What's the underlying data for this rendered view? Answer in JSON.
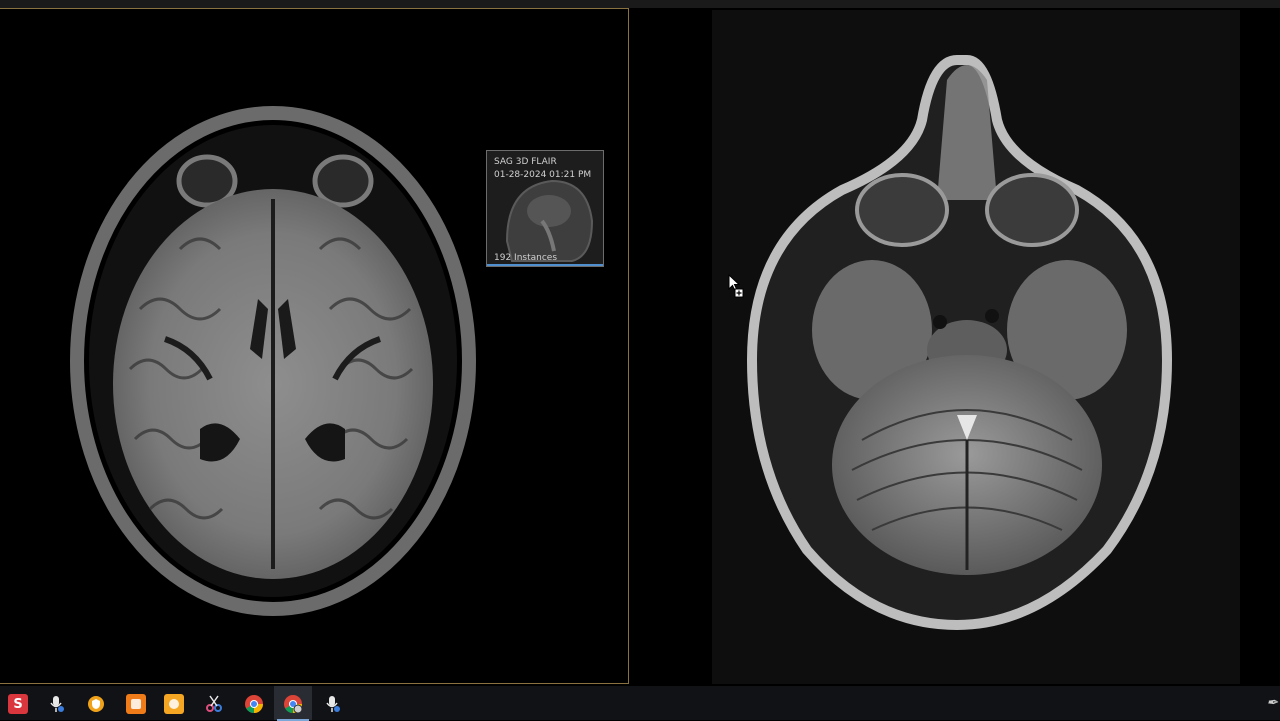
{
  "viewer": {
    "left_pane": {
      "series_type": "axial FLAIR brain MRI",
      "border_color": "#8a7140"
    },
    "right_pane": {
      "series_type": "axial T2 brain MRI"
    }
  },
  "series_thumbnail": {
    "title": "SAG 3D FLAIR",
    "datetime": "01-28-2024 01:21 PM",
    "instances": "192 Instances",
    "accent_color": "#4f8fcf"
  },
  "cursor": {
    "icon": "drag-copy-cursor-icon"
  },
  "taskbar": {
    "items": [
      {
        "name": "wps-office-icon",
        "glyph": "S",
        "color": "#d9363e",
        "active": false
      },
      {
        "name": "voice-access-mic-icon",
        "glyph": "",
        "color": "#2b2d33",
        "active": false
      },
      {
        "name": "vpn-shield-icon",
        "glyph": "",
        "color": "#f0a31a",
        "active": false
      },
      {
        "name": "orange-app-icon",
        "glyph": "",
        "color": "#f07b19",
        "active": false
      },
      {
        "name": "orange-box-app-icon",
        "glyph": "",
        "color": "#f5a623",
        "active": false
      },
      {
        "name": "snipping-tool-icon",
        "glyph": "",
        "color": "#2b2d33",
        "active": false
      },
      {
        "name": "chrome-icon",
        "glyph": "",
        "color": "#2b2d33",
        "active": false
      },
      {
        "name": "chrome-profile-icon",
        "glyph": "",
        "color": "#2b2d33",
        "active": true
      },
      {
        "name": "voice-recorder-mic-icon",
        "glyph": "",
        "color": "#2b2d33",
        "active": false
      }
    ],
    "tray_icon": "pen-icon"
  }
}
